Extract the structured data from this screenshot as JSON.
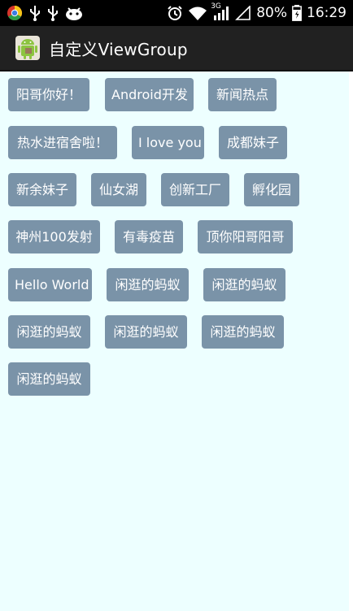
{
  "status_bar": {
    "network": "3G",
    "battery": "80%",
    "time": "16:29",
    "icons": [
      "chrome-notification-icon",
      "usb-icon",
      "usb-icon",
      "android-debug-icon",
      "alarm-icon",
      "wifi-icon",
      "signal-icon",
      "no-sim-signal-icon",
      "battery-charging-icon"
    ]
  },
  "action_bar": {
    "title": "自定义ViewGroup",
    "icon": "android-app-icon"
  },
  "tags": [
    "阳哥你好！",
    "Android开发",
    "新闻热点",
    "热水进宿舍啦！",
    "I love you",
    "成都妹子",
    "新余妹子",
    "仙女湖",
    "创新工厂",
    "孵化园",
    "神州100发射",
    "有毒疫苗",
    "顶你阳哥阳哥",
    "Hello World",
    "闲逛的蚂蚁",
    "闲逛的蚂蚁",
    "闲逛的蚂蚁",
    "闲逛的蚂蚁",
    "闲逛的蚂蚁",
    "闲逛的蚂蚁"
  ],
  "colors": {
    "tag_background": "#7a93a8",
    "content_background": "#edffff",
    "action_bar": "#212121",
    "status_bar": "#000000"
  }
}
